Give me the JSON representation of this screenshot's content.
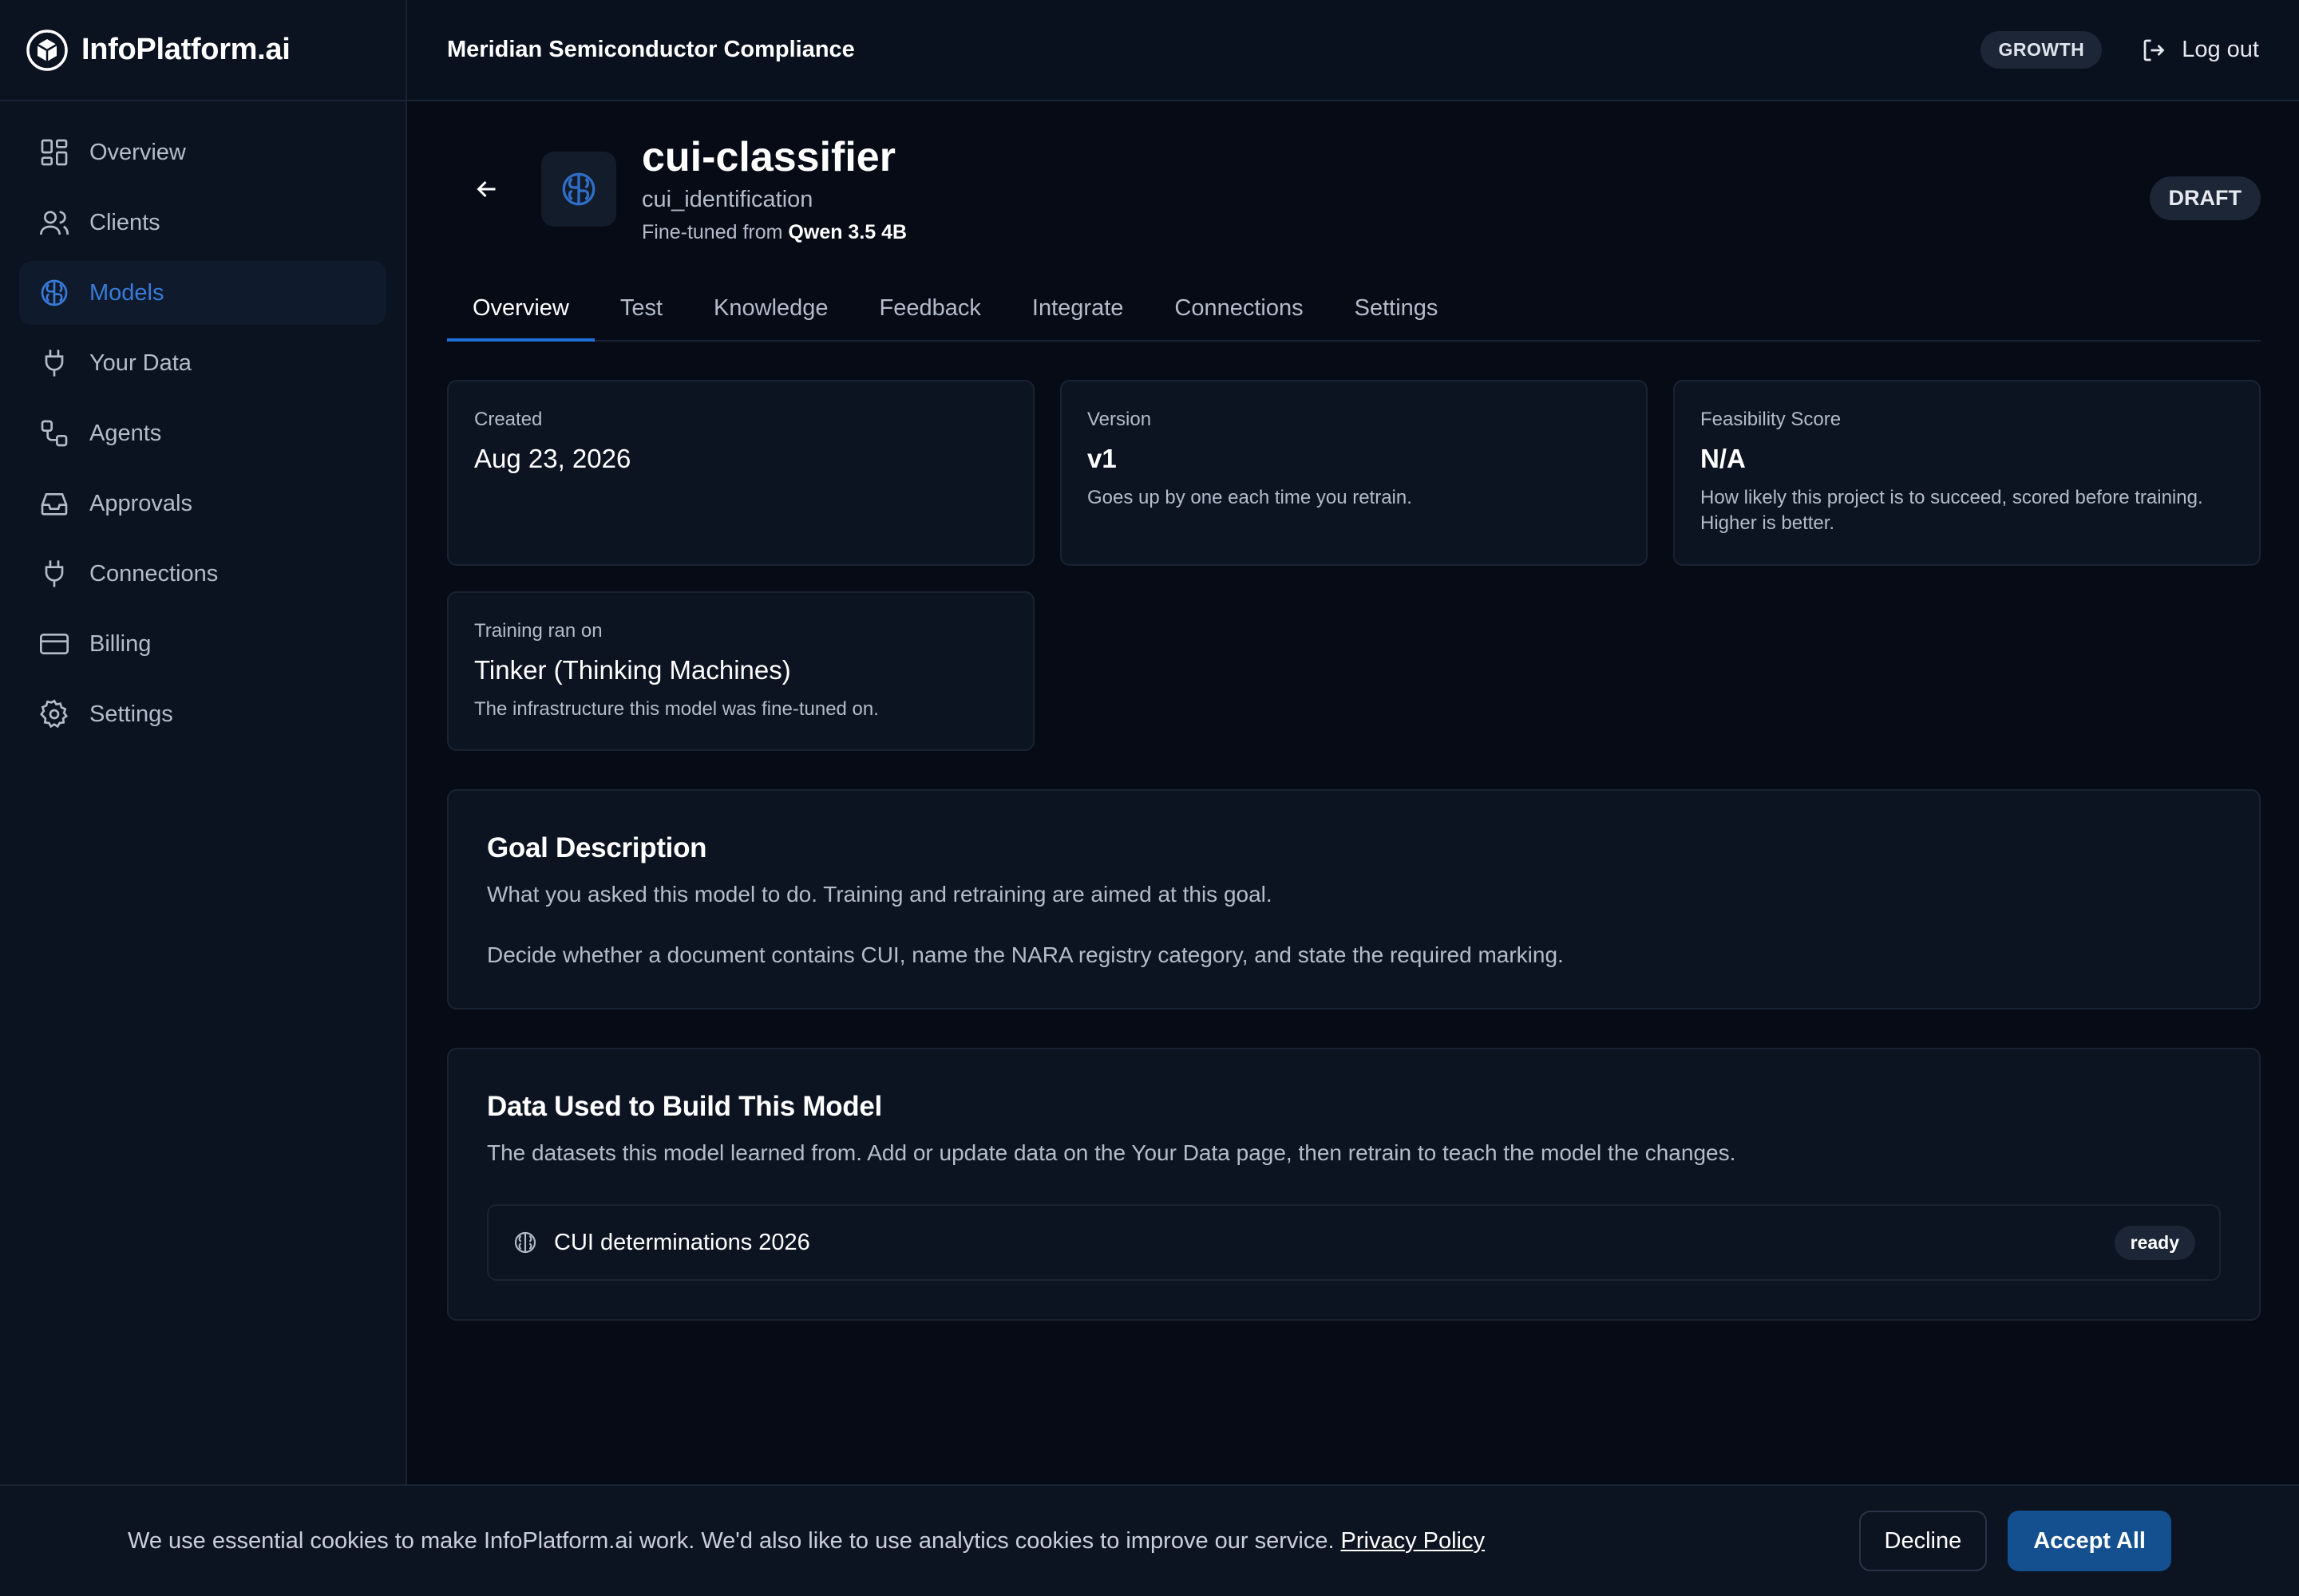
{
  "brand": {
    "name": "InfoPlatform.ai",
    "logo_icon": "cube-icon"
  },
  "topbar": {
    "org_name": "Meridian Semiconductor Compliance",
    "plan": "GROWTH",
    "logout_label": "Log out"
  },
  "sidebar": {
    "items": [
      {
        "label": "Overview",
        "icon": "grid-icon"
      },
      {
        "label": "Clients",
        "icon": "users-icon"
      },
      {
        "label": "Models",
        "icon": "brain-icon",
        "active": true
      },
      {
        "label": "Your Data",
        "icon": "plug-icon"
      },
      {
        "label": "Agents",
        "icon": "workflow-icon"
      },
      {
        "label": "Approvals",
        "icon": "inbox-icon"
      },
      {
        "label": "Connections",
        "icon": "plug-icon"
      },
      {
        "label": "Billing",
        "icon": "card-icon"
      },
      {
        "label": "Settings",
        "icon": "gear-icon"
      }
    ]
  },
  "model": {
    "title": "cui-classifier",
    "slug": "cui_identification",
    "base_prefix": "Fine-tuned from",
    "base_model": "Qwen 3.5 4B",
    "status": "DRAFT"
  },
  "tabs": [
    "Overview",
    "Test",
    "Knowledge",
    "Feedback",
    "Integrate",
    "Connections",
    "Settings"
  ],
  "active_tab": "Overview",
  "cards": {
    "created": {
      "label": "Created",
      "value": "Aug 23, 2026"
    },
    "version": {
      "label": "Version",
      "value": "v1",
      "help": "Goes up by one each time you retrain."
    },
    "feasibility": {
      "label": "Feasibility Score",
      "value": "N/A",
      "help": "How likely this project is to succeed, scored before training. Higher is better."
    },
    "training": {
      "label": "Training ran on",
      "value": "Tinker (Thinking Machines)",
      "help": "The infrastructure this model was fine-tuned on."
    }
  },
  "goal": {
    "title": "Goal Description",
    "subtitle": "What you asked this model to do. Training and retraining are aimed at this goal.",
    "text": "Decide whether a document contains CUI, name the NARA registry category, and state the required marking."
  },
  "data_used": {
    "title": "Data Used to Build This Model",
    "subtitle": "The datasets this model learned from. Add or update data on the Your Data page, then retrain to teach the model the changes.",
    "datasets": [
      {
        "name": "CUI determinations 2026",
        "status": "ready"
      }
    ]
  },
  "cookie": {
    "text": "We use essential cookies to make InfoPlatform.ai work. We'd also like to use analytics cookies to improve our service.",
    "link": "Privacy Policy",
    "decline": "Decline",
    "accept": "Accept All"
  },
  "colors": {
    "accent": "#1f6fd6",
    "active_nav": "#3a7ad9",
    "accept_button": "#14508f",
    "background": "#060b16"
  }
}
